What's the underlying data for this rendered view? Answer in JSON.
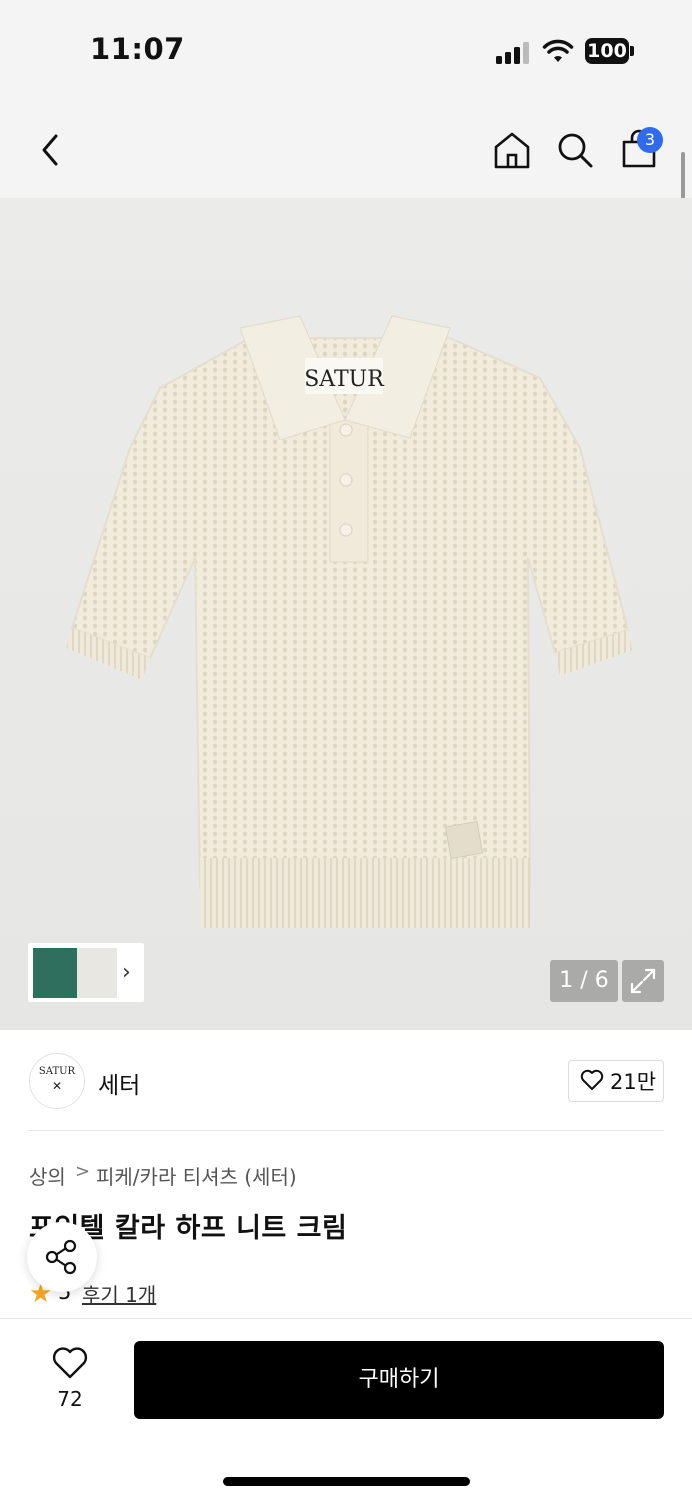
{
  "status_bar": {
    "time": "11:07",
    "battery": "100"
  },
  "nav": {
    "cart_count": "3"
  },
  "gallery": {
    "counter": "1 / 6",
    "image_brand_label": "SATUR"
  },
  "brand": {
    "logo_text": "SATUR",
    "logo_mark": "✕",
    "name": "세터",
    "likes": "21만"
  },
  "breadcrumb": {
    "category": "상의",
    "separator": ">",
    "subcategory": "피케/카라 티셔츠 (세터)"
  },
  "product": {
    "title": "포인텔 칼라 하프 니트 크림",
    "rating": "5",
    "review_link": "후기 1개"
  },
  "bottom_bar": {
    "wish_count": "72",
    "buy_label": "구매하기"
  },
  "colors": {
    "accent": "#2f6bea",
    "star": "#f5a623",
    "buy_button": "#000000",
    "knit": "#f1ebdc"
  }
}
